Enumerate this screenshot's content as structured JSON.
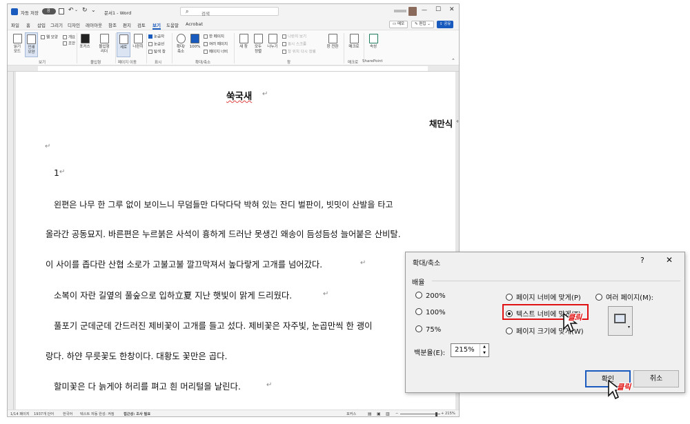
{
  "titlebar": {
    "autosave_label": "자동 저장",
    "autosave_state": "끔",
    "doc_title": "문서1 - Word",
    "search_placeholder": "검색"
  },
  "menu": [
    "파일",
    "홈",
    "삽입",
    "그리기",
    "디자인",
    "레이아웃",
    "참조",
    "편지",
    "검토",
    "보기",
    "도움말",
    "Acrobat"
  ],
  "menu_active": "보기",
  "menu_right": {
    "memo": "메모",
    "edit": "편집",
    "share": "공유"
  },
  "ribbon": {
    "views": {
      "read": "읽기\n모드",
      "print": "인쇄\n모양",
      "web": "웹 모양",
      "outline": "개요",
      "draft": "초안",
      "group": "보기"
    },
    "immersive": {
      "focus": "포커스",
      "reader": "몰입형\n리더",
      "group": "몰입형"
    },
    "page_move": {
      "vertical": "세로",
      "side": "나란히",
      "group": "페이지 이동"
    },
    "show": {
      "ruler": "눈금자",
      "grid": "눈금선",
      "nav": "탐색 창",
      "group": "표시"
    },
    "zoom": {
      "zoom": "확대/\n축소",
      "hundred": "100%",
      "one_page": "한 페이지",
      "multi_page": "여러 페이지",
      "page_width": "페이지 너비",
      "group": "확대/축소"
    },
    "window": {
      "new": "새 창",
      "arrange": "모두\n정렬",
      "split": "나누기",
      "side_by_side": "나란히 보기",
      "sync_scroll": "동시 스크롤",
      "reset": "창 위치 다시 정렬",
      "switch": "창 전환",
      "group": "창"
    },
    "macro": {
      "label": "매크로",
      "group": "매크로"
    },
    "sharepoint": {
      "label": "속성",
      "group": "SharePoint"
    }
  },
  "document": {
    "title": "쑥국새",
    "author": "채만식",
    "number": "1",
    "lines": [
      "왼편은 나무 한 그루 없이 보이느니 무덤들만 다닥다닥 박혀 있는 잔디 벌판이, 빗밋이 산발을 타고",
      "올라간 공동묘지. 바른편은 누르붉은 사석이 흉하게 드러난 못생긴 왜송이 듬성듬성 늘어붙은 산비탈.",
      "이 사이를 좁다란 산협 소로가 고불고불 깔끄막져서 높다랗게 고개를 넘어갔다.",
      "소복이 자란 길옆의 풀숲으로 입하立夏 지난 햇빛이 맑게 드리웠다.",
      "풀포기 군데군데 간드러진 제비꽃이 고개를 들고 섰다. 제비꽃은 자주빛, 눈곱만씩 한 괭이",
      "랑다. 하얀 무릇꽃도 한창이다. 대황도 꽃만은 곱다.",
      "할미꽃은 다 늙게야 허리를 펴고 흰 머리털을 날린다."
    ]
  },
  "statusbar": {
    "page": "1/14 페이지",
    "words": "1937개 단어",
    "lang": "한국어",
    "predict": "텍스트 자동 완성: 켜짐",
    "access": "접근성: 조사 필요",
    "focus": "포커스",
    "zoom": "215%"
  },
  "dialog": {
    "title": "확대/축소",
    "help": "?",
    "close": "✕",
    "section": "배율",
    "options_left": [
      "200%",
      "100%",
      "75%"
    ],
    "options_mid": [
      "페이지 너비에 맞게(P)",
      "텍스트 너비에 맞게(T)",
      "페이지 크기에 맞게(W)"
    ],
    "options_right": [
      "여러 페이지(M):"
    ],
    "percent_label": "백분율(E):",
    "percent_value": "215%",
    "ok": "확인",
    "cancel": "취소",
    "click_tag": "클릭"
  },
  "colors": {
    "accent": "#185abd",
    "highlight_box": "#e01010"
  }
}
